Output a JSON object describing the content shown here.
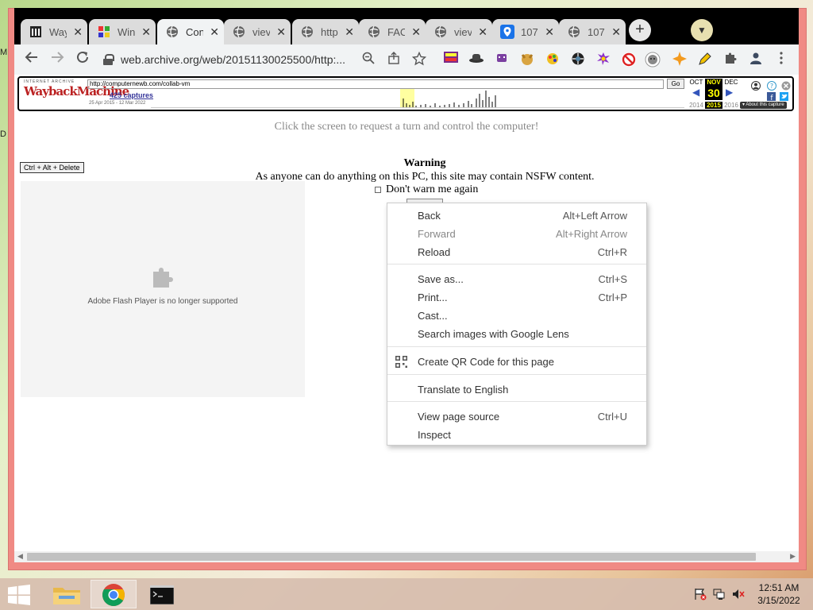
{
  "desktop": {
    "frag_m": "M",
    "frag_d": "D"
  },
  "tabs": [
    {
      "title": "Wayback Machine",
      "short": "Way",
      "icon": "archive-icon"
    },
    {
      "title": "Windows",
      "short": "Win",
      "icon": "windows-flag-icon"
    },
    {
      "title": "Computernewb",
      "short": "Con",
      "icon": "globe-icon",
      "active": true
    },
    {
      "title": "view",
      "short": "viev",
      "icon": "globe-icon"
    },
    {
      "title": "http",
      "short": "http",
      "icon": "globe-icon"
    },
    {
      "title": "FAQ",
      "short": "FAC",
      "icon": "globe-icon"
    },
    {
      "title": "view",
      "short": "viev",
      "icon": "globe-icon"
    },
    {
      "title": "107",
      "short": "107",
      "icon": "map-pin-icon"
    },
    {
      "title": "107",
      "short": "107",
      "icon": "globe-icon"
    }
  ],
  "newtab": "+",
  "address": {
    "url": "web.archive.org/web/20151130025500/http:..."
  },
  "wayback": {
    "url_field": "http://computernewb.com/collab-vm",
    "go": "Go",
    "captures": "425 captures",
    "range": "25 Apr 2015 - 12 Mar 2022",
    "months": {
      "prev": "OCT",
      "cur": "NOV",
      "next": "DEC"
    },
    "day": "30",
    "years": {
      "prev": "2014",
      "cur": "2015",
      "next": "2016"
    },
    "about": "▾ About this capture"
  },
  "page": {
    "click_msg": "Click the screen to request a turn and control the computer!",
    "cad_button": "Ctrl + Alt + Delete",
    "flash_msg": "Adobe Flash Player is no longer supported",
    "warning_title": "Warning",
    "warning_body": "As anyone can do anything on this PC, this site may contain NSFW content.",
    "dont_warn": "Don't warn me again"
  },
  "context_menu": {
    "back": {
      "label": "Back",
      "shortcut": "Alt+Left Arrow"
    },
    "forward": {
      "label": "Forward",
      "shortcut": "Alt+Right Arrow"
    },
    "reload": {
      "label": "Reload",
      "shortcut": "Ctrl+R"
    },
    "save_as": {
      "label": "Save as...",
      "shortcut": "Ctrl+S"
    },
    "print": {
      "label": "Print...",
      "shortcut": "Ctrl+P"
    },
    "cast": {
      "label": "Cast..."
    },
    "lens": {
      "label": "Search images with Google Lens"
    },
    "qr": {
      "label": "Create QR Code for this page"
    },
    "translate": {
      "label": "Translate to English"
    },
    "view_source": {
      "label": "View page source",
      "shortcut": "Ctrl+U"
    },
    "inspect": {
      "label": "Inspect"
    }
  },
  "taskbar": {
    "time": "12:51 AM",
    "date": "3/15/2022"
  },
  "colors": {
    "window_frame": "#f08a84",
    "wayback_red": "#b22222",
    "calendar_yellow": "#ffff00"
  }
}
